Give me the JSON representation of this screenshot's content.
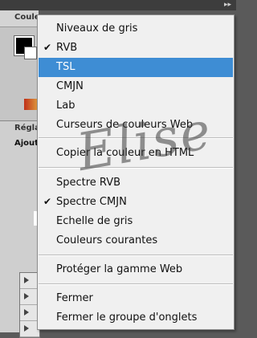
{
  "panel": {
    "tab_label": "Coule",
    "section1": "Régla",
    "section2": "Ajout"
  },
  "menu": {
    "items": [
      {
        "label": "Niveaux de gris",
        "checked": false,
        "selected": false
      },
      {
        "label": "RVB",
        "checked": true,
        "selected": false
      },
      {
        "label": "TSL",
        "checked": false,
        "selected": true
      },
      {
        "label": "CMJN",
        "checked": false,
        "selected": false
      },
      {
        "label": "Lab",
        "checked": false,
        "selected": false
      },
      {
        "label": "Curseurs de couleurs Web",
        "checked": false,
        "selected": false
      },
      {
        "label": "Copier la couleur en HTML",
        "checked": false,
        "selected": false
      },
      {
        "label": "Spectre RVB",
        "checked": false,
        "selected": false
      },
      {
        "label": "Spectre CMJN",
        "checked": true,
        "selected": false
      },
      {
        "label": "Echelle de gris",
        "checked": false,
        "selected": false
      },
      {
        "label": "Couleurs courantes",
        "checked": false,
        "selected": false
      },
      {
        "label": "Protéger la gamme Web",
        "checked": false,
        "selected": false
      },
      {
        "label": "Fermer",
        "checked": false,
        "selected": false
      },
      {
        "label": "Fermer le groupe d'onglets",
        "checked": false,
        "selected": false
      }
    ],
    "checkmark": "✔"
  },
  "watermark": "Elise",
  "colors": {
    "selection": "#3e8dd4",
    "menu_bg": "#f0f0f0"
  },
  "icons": {
    "collapse": "double-arrow-icon"
  }
}
